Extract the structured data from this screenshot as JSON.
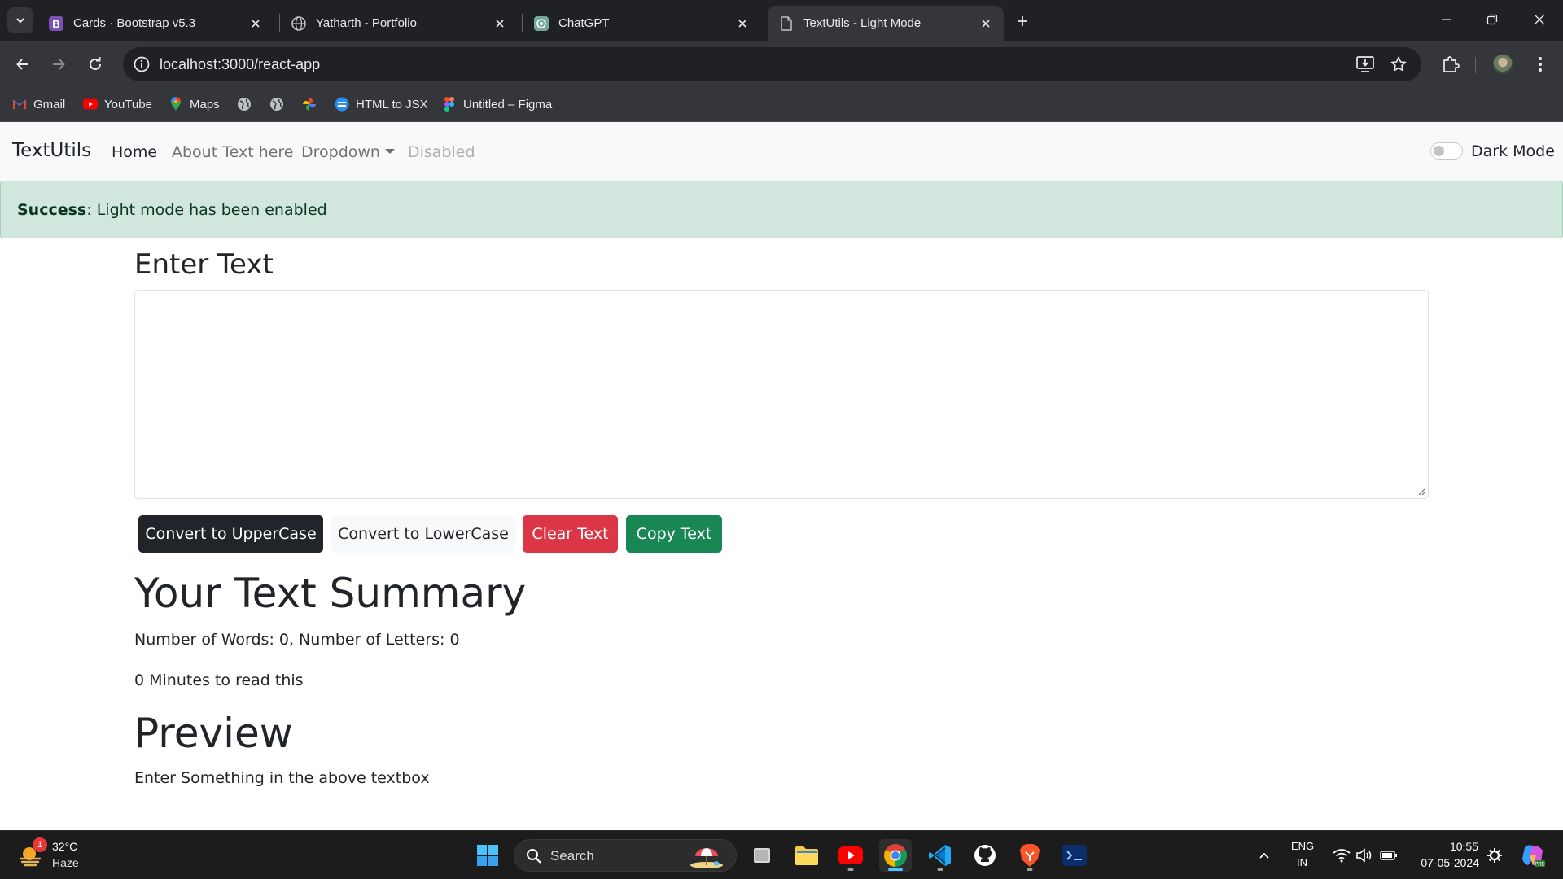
{
  "browser": {
    "tabs": [
      {
        "title": "Cards · Bootstrap v5.3",
        "favicon": "bootstrap-icon"
      },
      {
        "title": "Yatharth - Portfolio",
        "favicon": "globe-icon"
      },
      {
        "title": "ChatGPT",
        "favicon": "chatgpt-icon"
      },
      {
        "title": "TextUtils - Light Mode",
        "favicon": "page-icon",
        "active": true
      }
    ],
    "url": "localhost:3000/react-app",
    "bookmarks": [
      {
        "label": "Gmail",
        "icon": "gmail-icon"
      },
      {
        "label": "YouTube",
        "icon": "youtube-icon"
      },
      {
        "label": "Maps",
        "icon": "maps-icon"
      },
      {
        "label": "",
        "icon": "globe-icon"
      },
      {
        "label": "",
        "icon": "globe-icon"
      },
      {
        "label": "",
        "icon": "pinwheel-icon"
      },
      {
        "label": "HTML to JSX",
        "icon": "transform-icon"
      },
      {
        "label": "Untitled – Figma",
        "icon": "figma-icon"
      }
    ]
  },
  "app": {
    "brand": "TextUtils",
    "nav": {
      "home": "Home",
      "about": "About Text here",
      "dropdown": "Dropdown",
      "disabled": "Disabled"
    },
    "mode_toggle_label": "Dark Mode",
    "alert": {
      "type": "Success",
      "separator": ": ",
      "message": "Light mode has been enabled"
    },
    "heading": "Enter Text",
    "textarea_value": "",
    "buttons": {
      "upper": "Convert to UpperCase",
      "lower": "Convert to LowerCase",
      "clear": "Clear Text",
      "copy": "Copy Text"
    },
    "summary_heading": "Your Text Summary",
    "counts_line": "Number of Words: 0, Number of Letters: 0",
    "read_time_line": "0 Minutes to read this",
    "preview_heading": "Preview",
    "preview_text": "Enter Something in the above textbox"
  },
  "taskbar": {
    "weather_badge": "1",
    "temperature": "32°C",
    "condition": "Haze",
    "search_label": "Search",
    "lang_line1": "ENG",
    "lang_line2": "IN",
    "time": "10:55",
    "date": "07-05-2024"
  },
  "colors": {
    "chrome_dark": "#202124",
    "chrome_toolbar": "#35363a",
    "navbar_bg": "#f8f9fa",
    "alert_bg": "#d1e7dd",
    "btn_dark": "#212529",
    "btn_danger": "#dc3545",
    "btn_success": "#198754",
    "taskbar_bg": "#1c1c1c"
  }
}
